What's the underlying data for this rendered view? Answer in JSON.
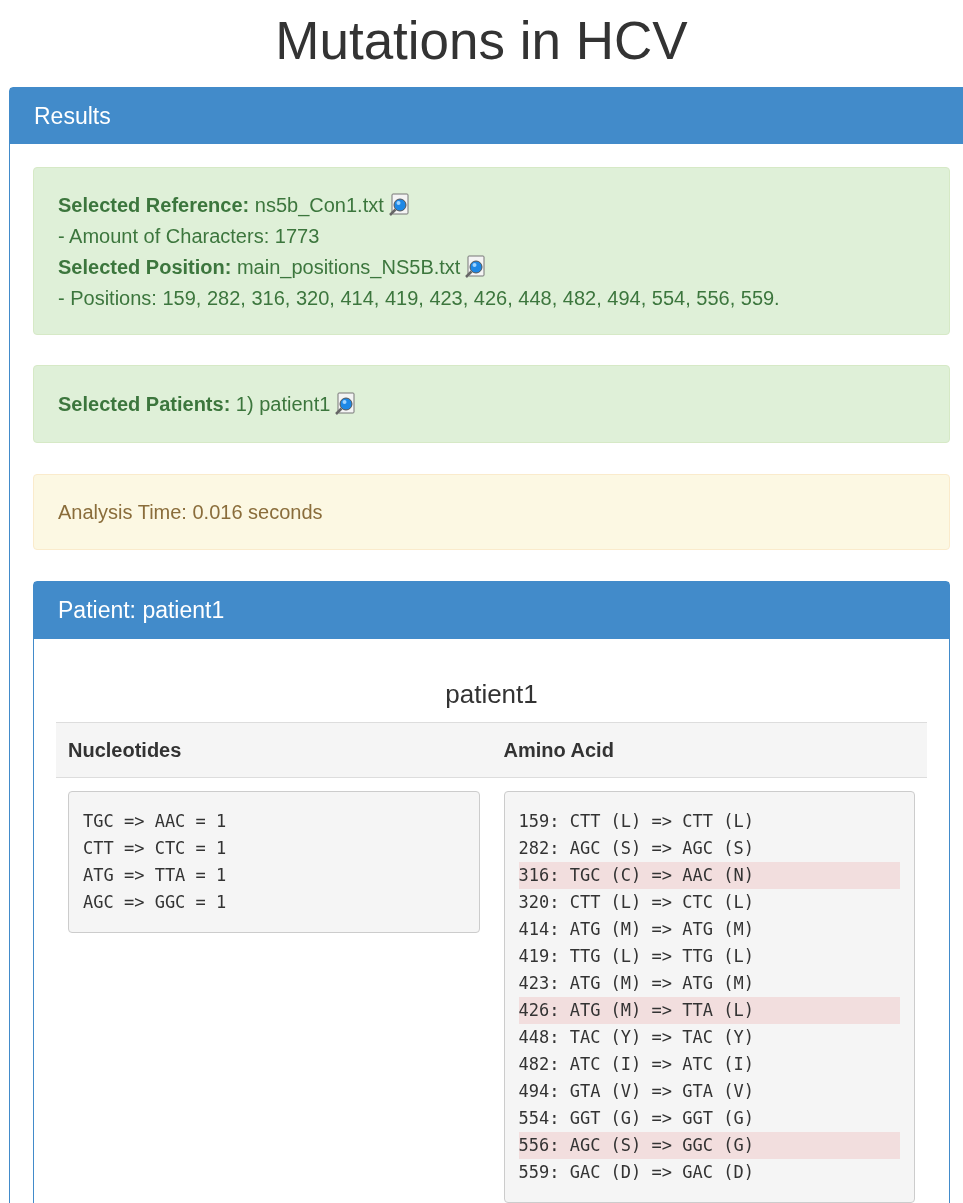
{
  "title": "Mutations in HCV",
  "results_panel": {
    "heading": "Results",
    "reference_box": {
      "lines": [
        {
          "kind": "file",
          "label": "Selected Reference:",
          "value": "ns5b_Con1.txt"
        },
        {
          "kind": "detail",
          "value": "- Amount of Characters: 1773"
        },
        {
          "kind": "file",
          "label": "Selected Position:",
          "value": "main_positions_NS5B.txt"
        },
        {
          "kind": "detail",
          "value": "- Positions: 159, 282, 316, 320, 414, 419, 423, 426, 448, 482, 494, 554, 556, 559."
        }
      ]
    },
    "patients_box": {
      "label": "Selected Patients:",
      "value": "1) patient1"
    },
    "analysis_time": "Analysis Time: 0.016 seconds",
    "patient_panel": {
      "heading": "Patient: patient1",
      "caption": "patient1",
      "columns": [
        "Nucleotides",
        "Amino Acid"
      ],
      "nucleotides": [
        {
          "text": "TGC => AAC = 1"
        },
        {
          "text": "CTT => CTC = 1"
        },
        {
          "text": "ATG => TTA = 1"
        },
        {
          "text": "AGC => GGC = 1"
        }
      ],
      "amino_acids": [
        {
          "text": "159: CTT (L) => CTT (L)",
          "highlighted": false
        },
        {
          "text": "282: AGC (S) => AGC (S)",
          "highlighted": false
        },
        {
          "text": "316: TGC (C) => AAC (N)",
          "highlighted": true
        },
        {
          "text": "320: CTT (L) => CTC (L)",
          "highlighted": false
        },
        {
          "text": "414: ATG (M) => ATG (M)",
          "highlighted": false
        },
        {
          "text": "419: TTG (L) => TTG (L)",
          "highlighted": false
        },
        {
          "text": "423: ATG (M) => ATG (M)",
          "highlighted": false
        },
        {
          "text": "426: ATG (M) => TTA (L)",
          "highlighted": true
        },
        {
          "text": "448: TAC (Y) => TAC (Y)",
          "highlighted": false
        },
        {
          "text": "482: ATC (I) => ATC (I)",
          "highlighted": false
        },
        {
          "text": "494: GTA (V) => GTA (V)",
          "highlighted": false
        },
        {
          "text": "554: GGT (G) => GGT (G)",
          "highlighted": false
        },
        {
          "text": "556: AGC (S) => GGC (G)",
          "highlighted": true
        },
        {
          "text": "559: GAC (D) => GAC (D)",
          "highlighted": false
        }
      ]
    }
  }
}
